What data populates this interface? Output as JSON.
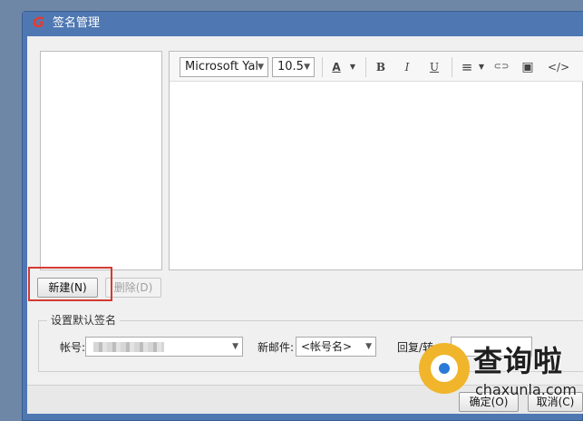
{
  "window": {
    "title": "签名管理",
    "logo": "G"
  },
  "toolbar": {
    "font_family": "Microsoft Yal",
    "font_size": "10.5",
    "font_color_glyph": "A",
    "bold_glyph": "B",
    "italic_glyph": "I",
    "underline_glyph": "U",
    "align_glyph": "≡",
    "link_glyph": "⊂⊃",
    "image_glyph": "▣",
    "source_glyph": "</>"
  },
  "buttons": {
    "new_label": "新建(N)",
    "delete_label": "删除(D)"
  },
  "default_signature": {
    "group_title": "设置默认签名",
    "account_label": "帐号:",
    "new_mail_label": "新邮件:",
    "new_mail_value": "<帐号名>",
    "reply_label": "回复/转"
  },
  "footer": {
    "ok_label": "确定(O)",
    "cancel_label": "取消(C)"
  },
  "watermark": {
    "text": "查询啦",
    "url": "chaxunla.com"
  },
  "colors": {
    "titlebar": "#4f78b2",
    "highlight": "#d33a32",
    "logo": "#e53c2e"
  }
}
